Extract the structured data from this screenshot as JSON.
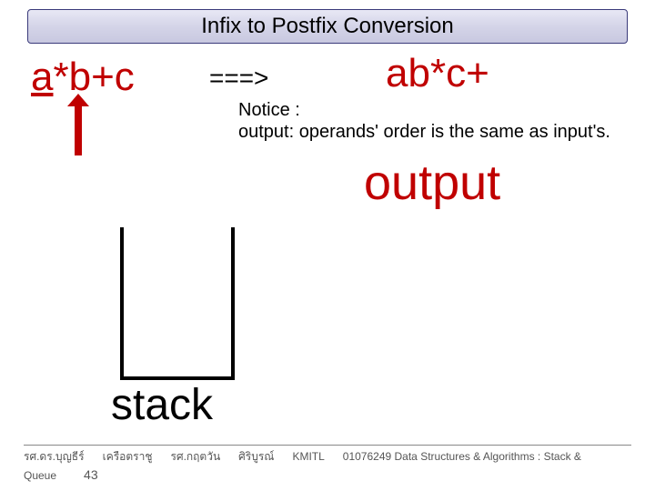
{
  "title": "Infix to Postfix Conversion",
  "infix": "a*b+c",
  "arrow": "===>",
  "postfix": "ab*c+",
  "notice_label": "Notice :",
  "notice_text": "output: operands' order is the same as input's.",
  "output_label": "output",
  "stack_label": "stack",
  "footer": {
    "author1": "รศ.ดร.บุญธีร์",
    "author2": "เครือตราชู",
    "author3": "รศ.กฤตวัน",
    "author4": "ศิริบูรณ์",
    "inst": "KMITL",
    "course": "01076249 Data Structures & Algorithms : Stack &",
    "course2": "Queue",
    "page": "43"
  }
}
